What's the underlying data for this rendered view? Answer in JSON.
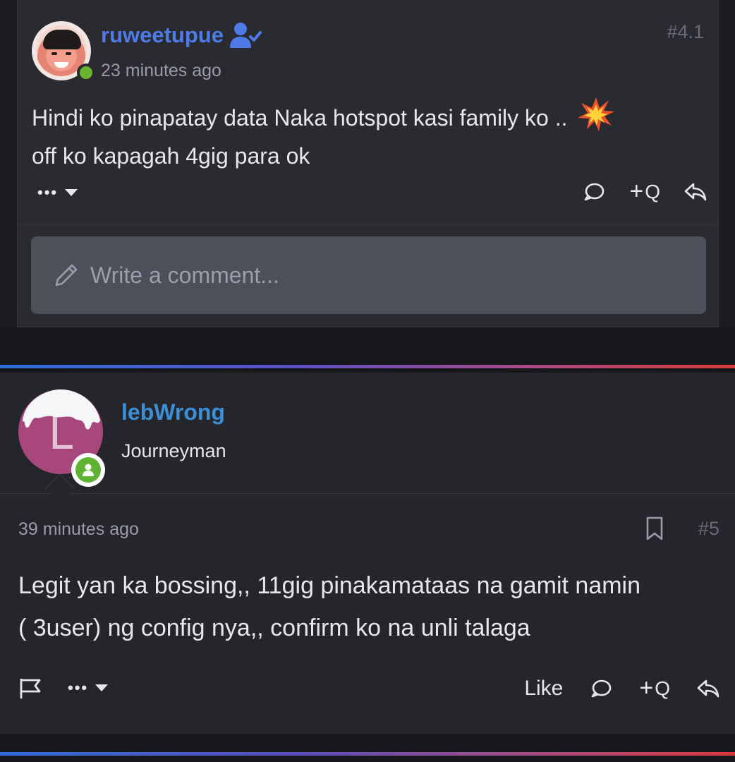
{
  "reply": {
    "username": "ruweetupue",
    "time": "23 minutes ago",
    "post_number": "#4.1",
    "body_line1": "Hindi ko pinapatay data Naka hotspot kasi family ko ..",
    "body_line2": "off ko kapagah 4gig para ok",
    "more_label": "•••",
    "quote_label": "Q",
    "comment_placeholder": "Write a comment..."
  },
  "post": {
    "username": "lebWrong",
    "avatar_letter": "L",
    "user_title": "Journeyman",
    "time": "39 minutes ago",
    "post_number": "#5",
    "body_line1": "Legit yan ka bossing,, 11gig pinakamataas na gamit namin",
    "body_line2": "( 3user) ng config nya,, confirm ko na unli talaga",
    "more_label": "•••",
    "like_label": "Like",
    "quote_label": "Q"
  },
  "colors": {
    "username_reply": "#4f7be8",
    "username_post": "#3c8fd6",
    "online": "#67b42f",
    "avatar_bg": "#a7477b"
  },
  "icons": [
    "verified-user-icon",
    "explosion-emoji-icon",
    "caret-down-icon",
    "comment-icon",
    "reply-icon",
    "pencil-icon",
    "bookmark-icon",
    "flag-icon",
    "user-badge-icon"
  ]
}
